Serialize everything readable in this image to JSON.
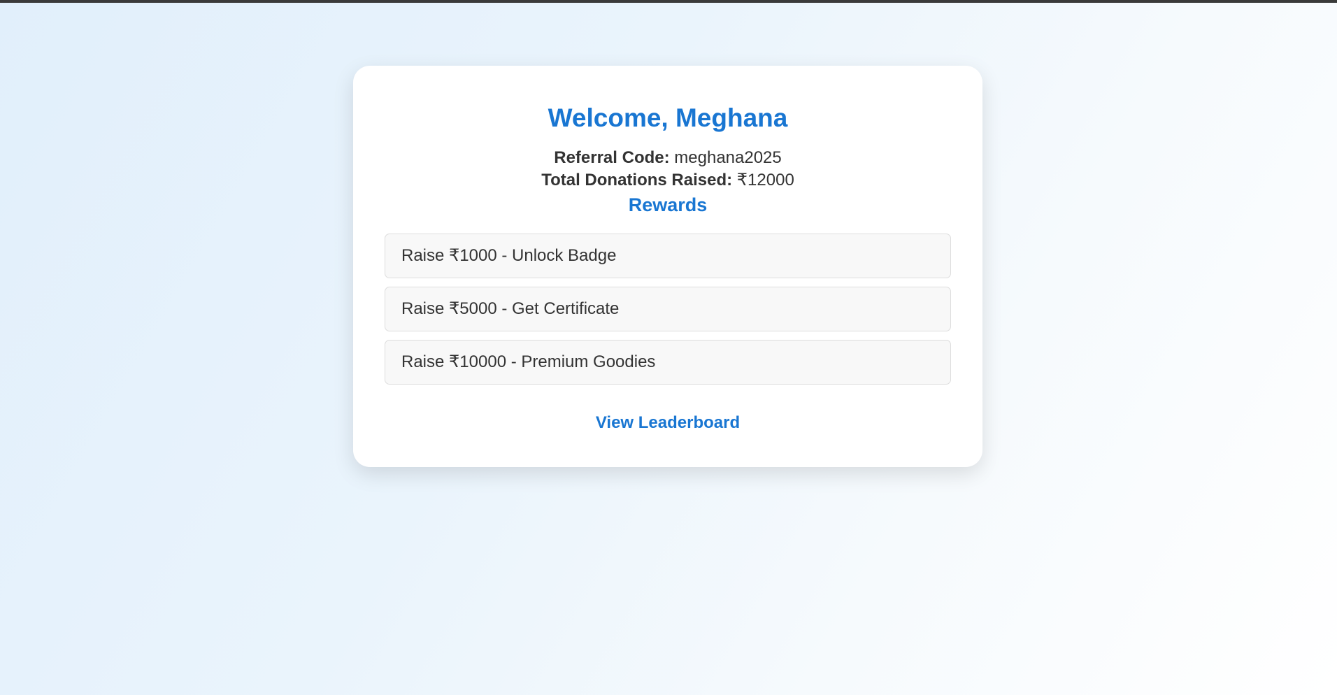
{
  "dashboard": {
    "welcome": "Welcome, Meghana",
    "referral_label": "Referral Code:",
    "referral_code": "meghana2025",
    "donations_label": "Total Donations Raised:",
    "donations_value": "₹12000"
  },
  "rewards": {
    "heading": "Rewards",
    "items": [
      {
        "label": "Raise ₹1000 - Unlock Badge"
      },
      {
        "label": "Raise ₹5000 - Get Certificate"
      },
      {
        "label": "Raise ₹10000 - Premium Goodies"
      }
    ]
  },
  "actions": {
    "leaderboard_label": "View Leaderboard"
  },
  "colors": {
    "accent": "#1976d2",
    "text": "#333333",
    "card_background": "#ffffff",
    "reward_background": "#f8f8f8"
  }
}
